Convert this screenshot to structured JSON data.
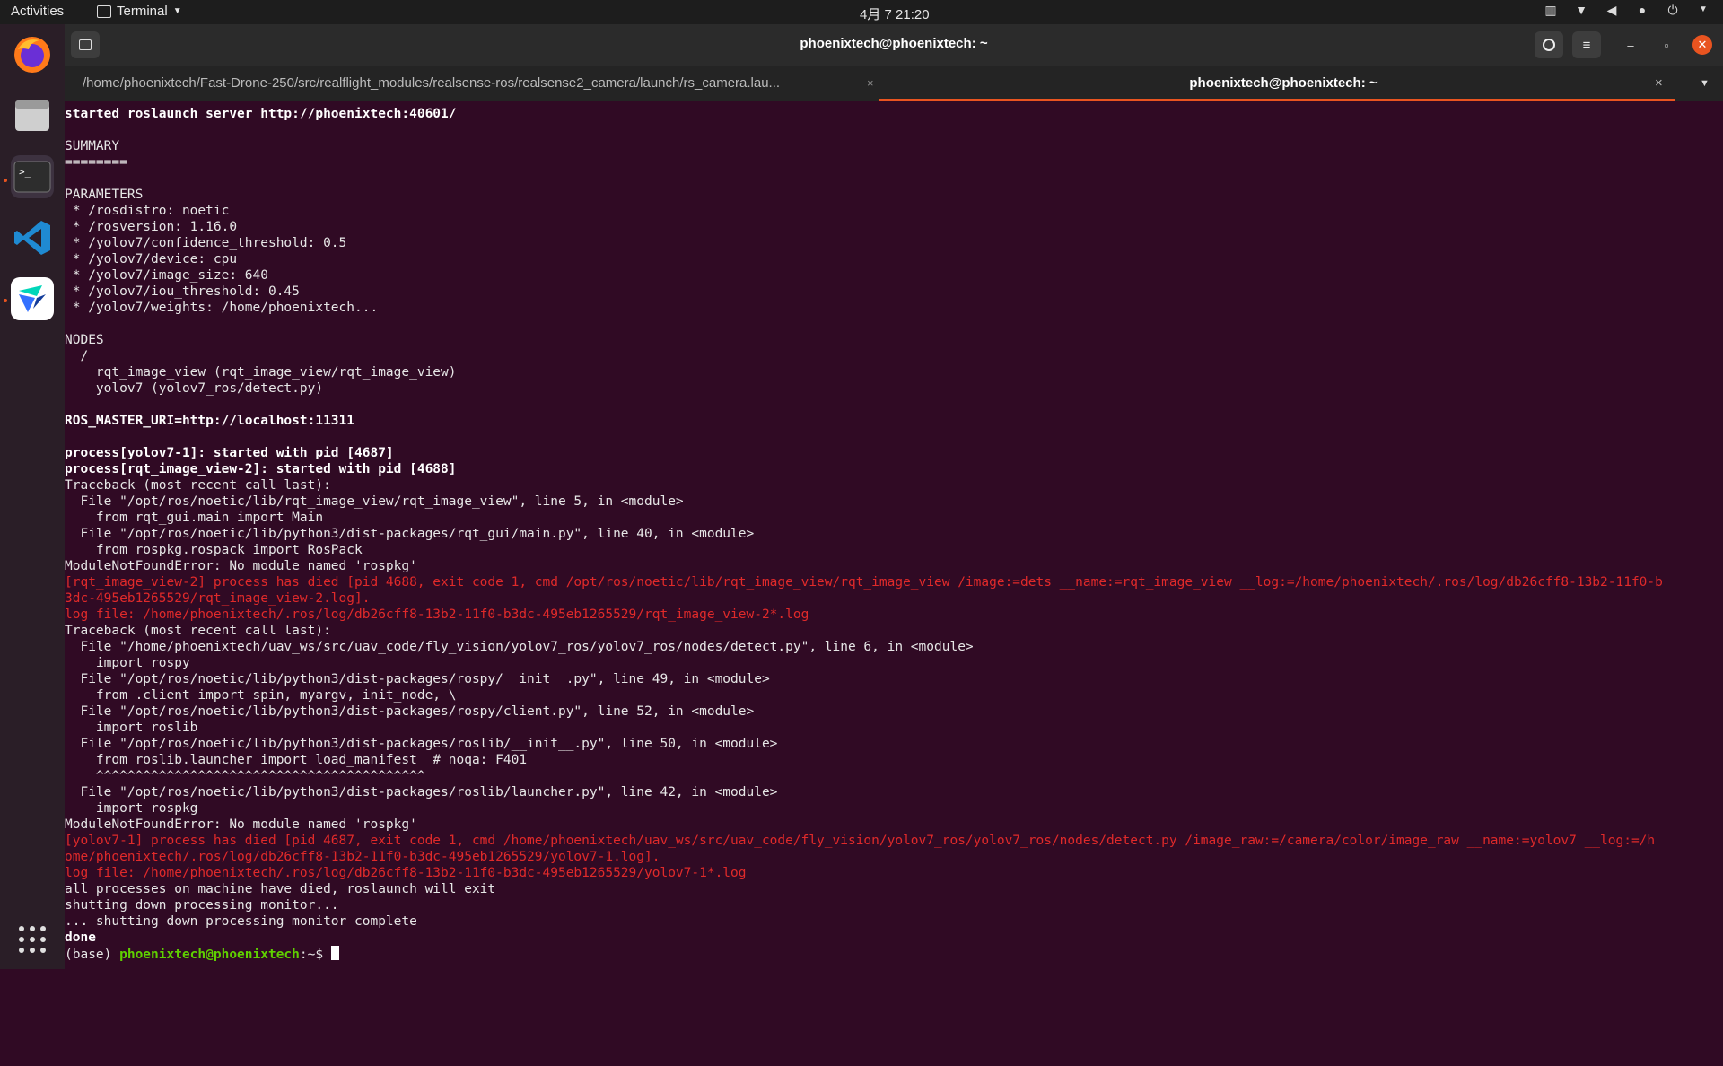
{
  "topbar": {
    "activities": "Activities",
    "app_menu": "Terminal",
    "clock": "4月 7 21:20"
  },
  "dock": {
    "apps": [
      "firefox-icon",
      "files-icon",
      "terminal-icon",
      "vscode-icon",
      "feishu-icon"
    ],
    "show_apps": "apps-grid-icon"
  },
  "window": {
    "title": "phoenixtech@phoenixtech: ~"
  },
  "tabs": [
    {
      "label": "/home/phoenixtech/Fast-Drone-250/src/realflight_modules/realsense-ros/realsense2_camera/launch/rs_camera.lau...",
      "close": "×"
    },
    {
      "label": "phoenixtech@phoenixtech: ~",
      "close": "×"
    }
  ],
  "terminal": {
    "lines": [
      {
        "t": "started roslaunch server http://phoenixtech:40601/",
        "c": "b"
      },
      {
        "t": "",
        "c": ""
      },
      {
        "t": "SUMMARY",
        "c": ""
      },
      {
        "t": "========",
        "c": ""
      },
      {
        "t": "",
        "c": ""
      },
      {
        "t": "PARAMETERS",
        "c": ""
      },
      {
        "t": " * /rosdistro: noetic",
        "c": ""
      },
      {
        "t": " * /rosversion: 1.16.0",
        "c": ""
      },
      {
        "t": " * /yolov7/confidence_threshold: 0.5",
        "c": ""
      },
      {
        "t": " * /yolov7/device: cpu",
        "c": ""
      },
      {
        "t": " * /yolov7/image_size: 640",
        "c": ""
      },
      {
        "t": " * /yolov7/iou_threshold: 0.45",
        "c": ""
      },
      {
        "t": " * /yolov7/weights: /home/phoenixtech...",
        "c": ""
      },
      {
        "t": "",
        "c": ""
      },
      {
        "t": "NODES",
        "c": ""
      },
      {
        "t": "  /",
        "c": ""
      },
      {
        "t": "    rqt_image_view (rqt_image_view/rqt_image_view)",
        "c": ""
      },
      {
        "t": "    yolov7 (yolov7_ros/detect.py)",
        "c": ""
      },
      {
        "t": "",
        "c": ""
      },
      {
        "t": "ROS_MASTER_URI=http://localhost:11311",
        "c": "b"
      },
      {
        "t": "",
        "c": ""
      },
      {
        "t": "process[yolov7-1]: started with pid [4687]",
        "c": "b"
      },
      {
        "t": "process[rqt_image_view-2]: started with pid [4688]",
        "c": "b"
      },
      {
        "t": "Traceback (most recent call last):",
        "c": ""
      },
      {
        "t": "  File \"/opt/ros/noetic/lib/rqt_image_view/rqt_image_view\", line 5, in <module>",
        "c": ""
      },
      {
        "t": "    from rqt_gui.main import Main",
        "c": ""
      },
      {
        "t": "  File \"/opt/ros/noetic/lib/python3/dist-packages/rqt_gui/main.py\", line 40, in <module>",
        "c": ""
      },
      {
        "t": "    from rospkg.rospack import RosPack",
        "c": ""
      },
      {
        "t": "ModuleNotFoundError: No module named 'rospkg'",
        "c": ""
      },
      {
        "t": "[rqt_image_view-2] process has died [pid 4688, exit code 1, cmd /opt/ros/noetic/lib/rqt_image_view/rqt_image_view /image:=dets __name:=rqt_image_view __log:=/home/phoenixtech/.ros/log/db26cff8-13b2-11f0-b",
        "c": "r"
      },
      {
        "t": "3dc-495eb1265529/rqt_image_view-2.log].",
        "c": "r"
      },
      {
        "t": "log file: /home/phoenixtech/.ros/log/db26cff8-13b2-11f0-b3dc-495eb1265529/rqt_image_view-2*.log",
        "c": "r"
      },
      {
        "t": "Traceback (most recent call last):",
        "c": ""
      },
      {
        "t": "  File \"/home/phoenixtech/uav_ws/src/uav_code/fly_vision/yolov7_ros/yolov7_ros/nodes/detect.py\", line 6, in <module>",
        "c": ""
      },
      {
        "t": "    import rospy",
        "c": ""
      },
      {
        "t": "  File \"/opt/ros/noetic/lib/python3/dist-packages/rospy/__init__.py\", line 49, in <module>",
        "c": ""
      },
      {
        "t": "    from .client import spin, myargv, init_node, \\",
        "c": ""
      },
      {
        "t": "  File \"/opt/ros/noetic/lib/python3/dist-packages/rospy/client.py\", line 52, in <module>",
        "c": ""
      },
      {
        "t": "    import roslib",
        "c": ""
      },
      {
        "t": "  File \"/opt/ros/noetic/lib/python3/dist-packages/roslib/__init__.py\", line 50, in <module>",
        "c": ""
      },
      {
        "t": "    from roslib.launcher import load_manifest  # noqa: F401",
        "c": ""
      },
      {
        "t": "    ^^^^^^^^^^^^^^^^^^^^^^^^^^^^^^^^^^^^^^^^^^",
        "c": ""
      },
      {
        "t": "  File \"/opt/ros/noetic/lib/python3/dist-packages/roslib/launcher.py\", line 42, in <module>",
        "c": ""
      },
      {
        "t": "    import rospkg",
        "c": ""
      },
      {
        "t": "ModuleNotFoundError: No module named 'rospkg'",
        "c": ""
      },
      {
        "t": "[yolov7-1] process has died [pid 4687, exit code 1, cmd /home/phoenixtech/uav_ws/src/uav_code/fly_vision/yolov7_ros/yolov7_ros/nodes/detect.py /image_raw:=/camera/color/image_raw __name:=yolov7 __log:=/h",
        "c": "r"
      },
      {
        "t": "ome/phoenixtech/.ros/log/db26cff8-13b2-11f0-b3dc-495eb1265529/yolov7-1.log].",
        "c": "r"
      },
      {
        "t": "log file: /home/phoenixtech/.ros/log/db26cff8-13b2-11f0-b3dc-495eb1265529/yolov7-1*.log",
        "c": "r"
      },
      {
        "t": "all processes on machine have died, roslaunch will exit",
        "c": ""
      },
      {
        "t": "shutting down processing monitor...",
        "c": ""
      },
      {
        "t": "... shutting down processing monitor complete",
        "c": ""
      },
      {
        "t": "done",
        "c": "b"
      }
    ],
    "prompt_env": "(base) ",
    "prompt_user": "phoenixtech@phoenixtech",
    "prompt_path": ":~$ "
  }
}
